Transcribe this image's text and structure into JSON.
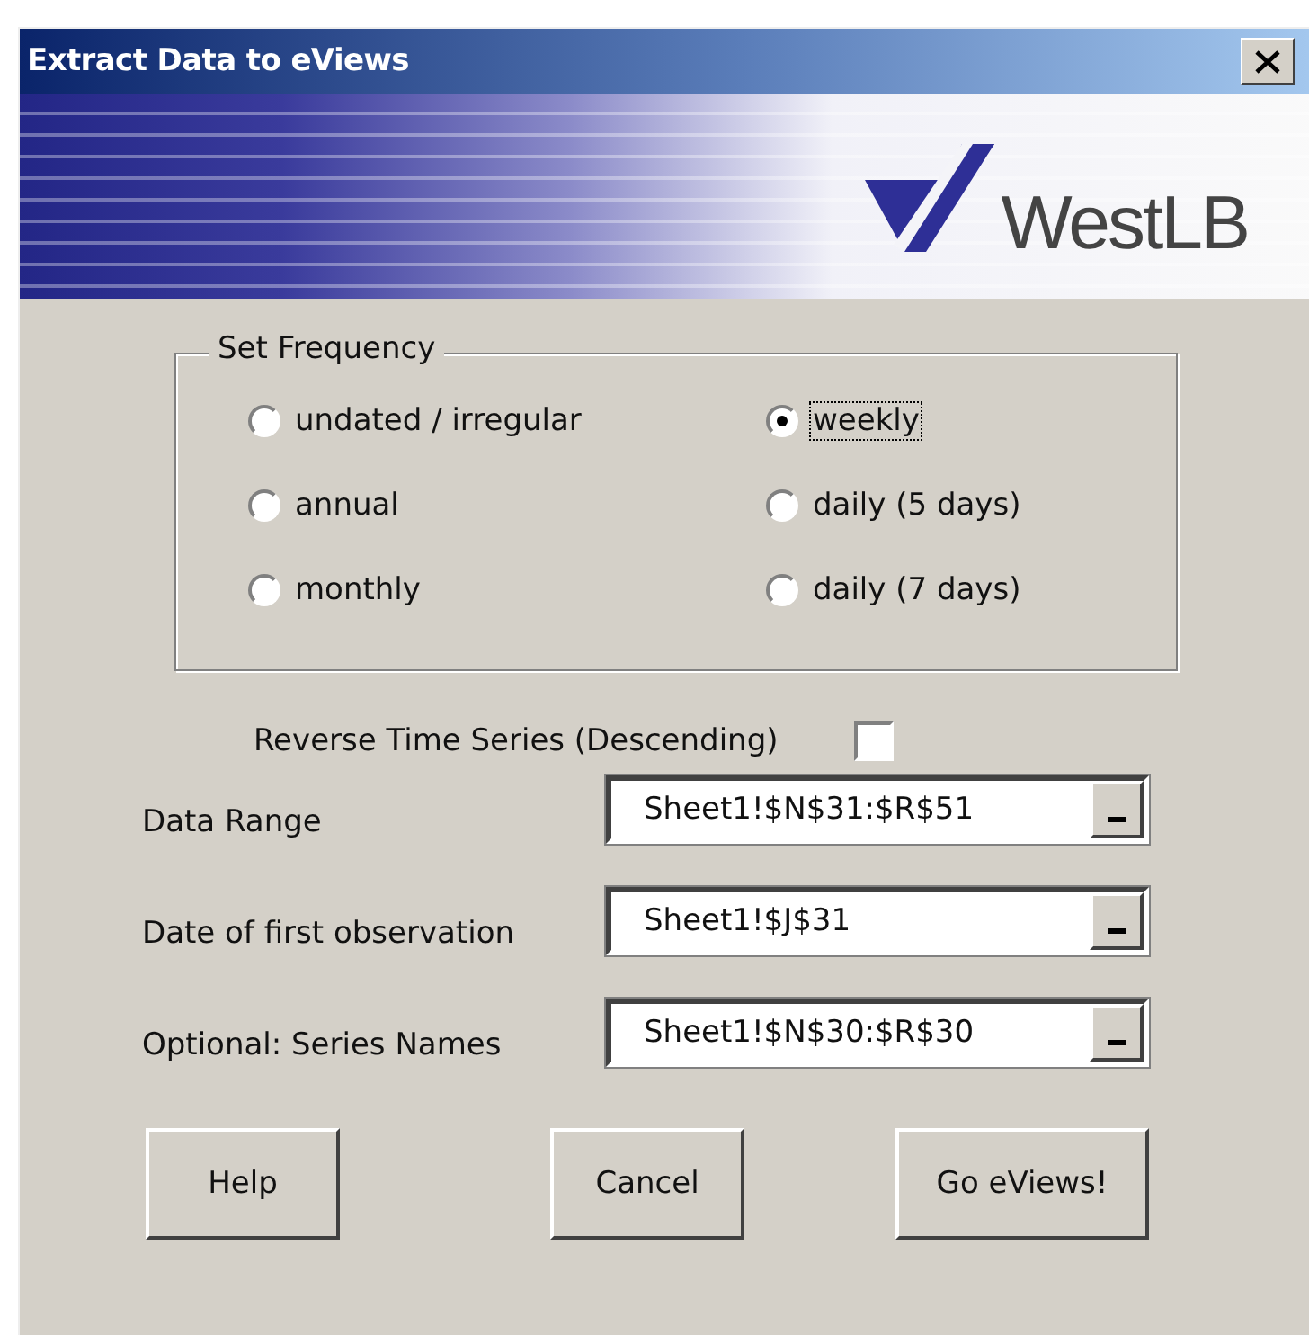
{
  "window": {
    "title": "Extract Data to eViews"
  },
  "banner": {
    "logo_text": "WestLB"
  },
  "frequency": {
    "title": "Set Frequency",
    "options": [
      {
        "label": "undated / irregular",
        "selected": false,
        "focused": false
      },
      {
        "label": "annual",
        "selected": false,
        "focused": false
      },
      {
        "label": "monthly",
        "selected": false,
        "focused": false
      },
      {
        "label": "weekly",
        "selected": true,
        "focused": true
      },
      {
        "label": "daily (5 days)",
        "selected": false,
        "focused": false
      },
      {
        "label": "daily (7 days)",
        "selected": false,
        "focused": false
      }
    ]
  },
  "reverse": {
    "label": "Reverse Time Series (Descending)",
    "checked": false
  },
  "ranges": [
    {
      "label": "Data Range",
      "value": "Sheet1!$N$31:$R$51"
    },
    {
      "label": "Date of first observation",
      "value": "Sheet1!$J$31"
    },
    {
      "label": "Optional: Series Names",
      "value": "Sheet1!$N$30:$R$30"
    }
  ],
  "buttons": [
    "Help",
    "Cancel",
    "Go eViews!"
  ]
}
